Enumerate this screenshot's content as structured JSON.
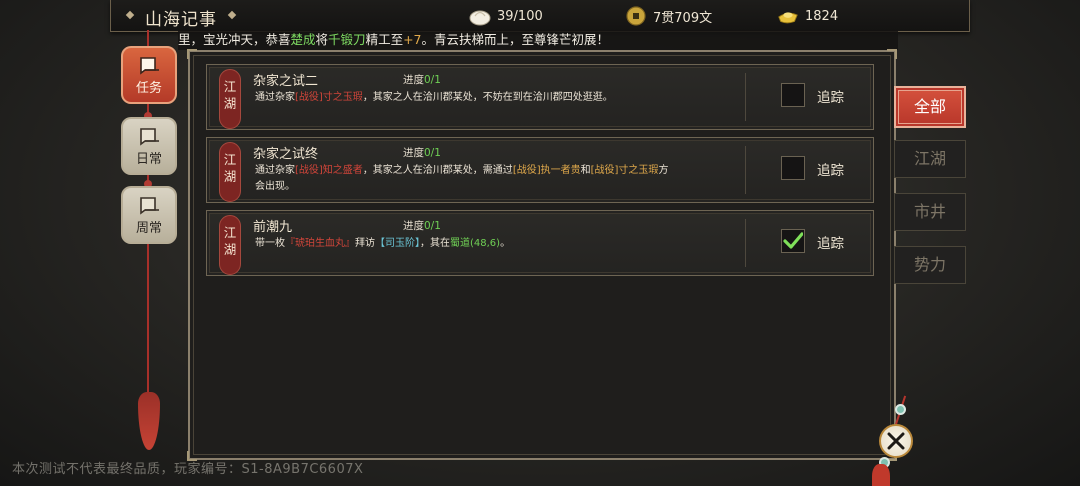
{
  "header": {
    "title": "山海记事",
    "resources": [
      {
        "icon": "steamed-bun-icon",
        "value": "39/100"
      },
      {
        "icon": "copper-coin-icon",
        "value": "7贯709文"
      },
      {
        "icon": "gold-ingot-icon",
        "value": "1824"
      }
    ]
  },
  "ticker": {
    "p1": "里，宝光冲天，恭喜",
    "name": "楚成",
    "p2": "将",
    "item": "千锻刀",
    "p3": "精工至",
    "level": "+7",
    "p4": "。青云扶梯而上，至尊锋芒初展！"
  },
  "left_tabs": [
    {
      "label": "任务",
      "active": true
    },
    {
      "label": "日常",
      "active": false
    },
    {
      "label": "周常",
      "active": false
    }
  ],
  "right_tabs": [
    {
      "label": "全部",
      "active": true
    },
    {
      "label": "江湖",
      "active": false
    },
    {
      "label": "市井",
      "active": false
    },
    {
      "label": "势力",
      "active": false
    }
  ],
  "progress_label": "进度",
  "track_label": "追踪",
  "quests": [
    {
      "category": "江湖",
      "name": "杂家之试二",
      "progress": "0/1",
      "tracked": false,
      "desc": {
        "a": "通过杂家",
        "b": "[战役]寸之玉瑕",
        "c": "，其家之人在洽川郡某处，不妨在到在洽川郡四处逛逛。"
      }
    },
    {
      "category": "江湖",
      "name": "杂家之试终",
      "progress": "0/1",
      "tracked": false,
      "desc": {
        "a": "通过杂家",
        "b": "[战役]知之盛者",
        "c": "，其家之人在洽川郡某处，需通过",
        "d": "[战役]执一者贵",
        "e": "和",
        "f": "[战役]寸之玉瑕",
        "g": "方",
        "h": "会出现。"
      }
    },
    {
      "category": "江湖",
      "name": "前潮九",
      "progress": "0/1",
      "tracked": true,
      "desc": {
        "a": "带一枚",
        "b": "『琥珀生血丸』",
        "c": "拜访",
        "d": "【司玉阶】",
        "e": "，其在",
        "f": "蜀道(48,6)",
        "g": "。"
      }
    }
  ],
  "watermark": "本次测试不代表最终品质，玩家编号：S1-8A9B7C6607X",
  "colors": {
    "accent_red": "#b8362a",
    "highlight_green": "#6fcf55",
    "highlight_orange": "#e0a94b",
    "highlight_red": "#d1453a",
    "highlight_cyan": "#6bc5d6"
  }
}
